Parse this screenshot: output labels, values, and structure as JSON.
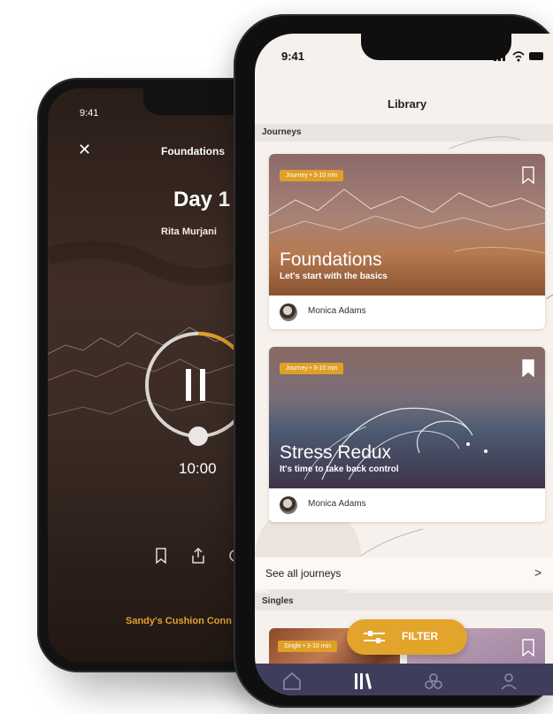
{
  "player": {
    "status_time": "9:41",
    "close_glyph": "✕",
    "journey_title": "Foundations",
    "day_label": "Day 1",
    "author": "Rita Murjani",
    "timer": "10:00",
    "footer_text": "Sandy's Cushion Conn",
    "progress": 0.3,
    "icons": [
      "bookmark-icon",
      "share-icon",
      "settings-icon"
    ]
  },
  "library": {
    "status_time": "9:41",
    "title": "Library",
    "journeys_label": "Journeys",
    "cards": [
      {
        "badge": "Journey • 3-10 min",
        "title": "Foundations",
        "subtitle": "Let's start with the basics",
        "author": "Monica Adams",
        "bookmarked": false
      },
      {
        "badge": "Journey • 3-10 min",
        "title": "Stress Redux",
        "subtitle": "It's time to take back control",
        "author": "Monica Adams",
        "bookmarked": true
      }
    ],
    "see_all": "See all journeys",
    "see_all_chevron": ">",
    "singles_label": "Singles",
    "single_badge": "Single • 3-10 min",
    "filter_label": "FILTER",
    "tabs": [
      "home-icon",
      "library-icon",
      "community-icon",
      "profile-icon"
    ],
    "colors": {
      "accent": "#e0a028",
      "tabbar": "#3e3e5c",
      "background": "#f6f1ec"
    }
  }
}
